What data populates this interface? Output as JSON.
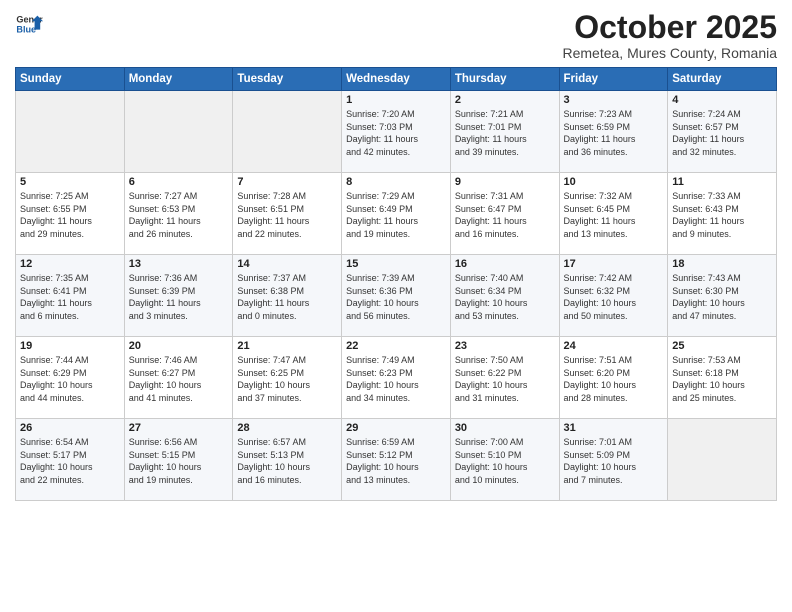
{
  "header": {
    "logo_general": "General",
    "logo_blue": "Blue",
    "month_title": "October 2025",
    "subtitle": "Remetea, Mures County, Romania"
  },
  "days_of_week": [
    "Sunday",
    "Monday",
    "Tuesday",
    "Wednesday",
    "Thursday",
    "Friday",
    "Saturday"
  ],
  "weeks": [
    [
      {
        "day": "",
        "info": ""
      },
      {
        "day": "",
        "info": ""
      },
      {
        "day": "",
        "info": ""
      },
      {
        "day": "1",
        "info": "Sunrise: 7:20 AM\nSunset: 7:03 PM\nDaylight: 11 hours\nand 42 minutes."
      },
      {
        "day": "2",
        "info": "Sunrise: 7:21 AM\nSunset: 7:01 PM\nDaylight: 11 hours\nand 39 minutes."
      },
      {
        "day": "3",
        "info": "Sunrise: 7:23 AM\nSunset: 6:59 PM\nDaylight: 11 hours\nand 36 minutes."
      },
      {
        "day": "4",
        "info": "Sunrise: 7:24 AM\nSunset: 6:57 PM\nDaylight: 11 hours\nand 32 minutes."
      }
    ],
    [
      {
        "day": "5",
        "info": "Sunrise: 7:25 AM\nSunset: 6:55 PM\nDaylight: 11 hours\nand 29 minutes."
      },
      {
        "day": "6",
        "info": "Sunrise: 7:27 AM\nSunset: 6:53 PM\nDaylight: 11 hours\nand 26 minutes."
      },
      {
        "day": "7",
        "info": "Sunrise: 7:28 AM\nSunset: 6:51 PM\nDaylight: 11 hours\nand 22 minutes."
      },
      {
        "day": "8",
        "info": "Sunrise: 7:29 AM\nSunset: 6:49 PM\nDaylight: 11 hours\nand 19 minutes."
      },
      {
        "day": "9",
        "info": "Sunrise: 7:31 AM\nSunset: 6:47 PM\nDaylight: 11 hours\nand 16 minutes."
      },
      {
        "day": "10",
        "info": "Sunrise: 7:32 AM\nSunset: 6:45 PM\nDaylight: 11 hours\nand 13 minutes."
      },
      {
        "day": "11",
        "info": "Sunrise: 7:33 AM\nSunset: 6:43 PM\nDaylight: 11 hours\nand 9 minutes."
      }
    ],
    [
      {
        "day": "12",
        "info": "Sunrise: 7:35 AM\nSunset: 6:41 PM\nDaylight: 11 hours\nand 6 minutes."
      },
      {
        "day": "13",
        "info": "Sunrise: 7:36 AM\nSunset: 6:39 PM\nDaylight: 11 hours\nand 3 minutes."
      },
      {
        "day": "14",
        "info": "Sunrise: 7:37 AM\nSunset: 6:38 PM\nDaylight: 11 hours\nand 0 minutes."
      },
      {
        "day": "15",
        "info": "Sunrise: 7:39 AM\nSunset: 6:36 PM\nDaylight: 10 hours\nand 56 minutes."
      },
      {
        "day": "16",
        "info": "Sunrise: 7:40 AM\nSunset: 6:34 PM\nDaylight: 10 hours\nand 53 minutes."
      },
      {
        "day": "17",
        "info": "Sunrise: 7:42 AM\nSunset: 6:32 PM\nDaylight: 10 hours\nand 50 minutes."
      },
      {
        "day": "18",
        "info": "Sunrise: 7:43 AM\nSunset: 6:30 PM\nDaylight: 10 hours\nand 47 minutes."
      }
    ],
    [
      {
        "day": "19",
        "info": "Sunrise: 7:44 AM\nSunset: 6:29 PM\nDaylight: 10 hours\nand 44 minutes."
      },
      {
        "day": "20",
        "info": "Sunrise: 7:46 AM\nSunset: 6:27 PM\nDaylight: 10 hours\nand 41 minutes."
      },
      {
        "day": "21",
        "info": "Sunrise: 7:47 AM\nSunset: 6:25 PM\nDaylight: 10 hours\nand 37 minutes."
      },
      {
        "day": "22",
        "info": "Sunrise: 7:49 AM\nSunset: 6:23 PM\nDaylight: 10 hours\nand 34 minutes."
      },
      {
        "day": "23",
        "info": "Sunrise: 7:50 AM\nSunset: 6:22 PM\nDaylight: 10 hours\nand 31 minutes."
      },
      {
        "day": "24",
        "info": "Sunrise: 7:51 AM\nSunset: 6:20 PM\nDaylight: 10 hours\nand 28 minutes."
      },
      {
        "day": "25",
        "info": "Sunrise: 7:53 AM\nSunset: 6:18 PM\nDaylight: 10 hours\nand 25 minutes."
      }
    ],
    [
      {
        "day": "26",
        "info": "Sunrise: 6:54 AM\nSunset: 5:17 PM\nDaylight: 10 hours\nand 22 minutes."
      },
      {
        "day": "27",
        "info": "Sunrise: 6:56 AM\nSunset: 5:15 PM\nDaylight: 10 hours\nand 19 minutes."
      },
      {
        "day": "28",
        "info": "Sunrise: 6:57 AM\nSunset: 5:13 PM\nDaylight: 10 hours\nand 16 minutes."
      },
      {
        "day": "29",
        "info": "Sunrise: 6:59 AM\nSunset: 5:12 PM\nDaylight: 10 hours\nand 13 minutes."
      },
      {
        "day": "30",
        "info": "Sunrise: 7:00 AM\nSunset: 5:10 PM\nDaylight: 10 hours\nand 10 minutes."
      },
      {
        "day": "31",
        "info": "Sunrise: 7:01 AM\nSunset: 5:09 PM\nDaylight: 10 hours\nand 7 minutes."
      },
      {
        "day": "",
        "info": ""
      }
    ]
  ]
}
